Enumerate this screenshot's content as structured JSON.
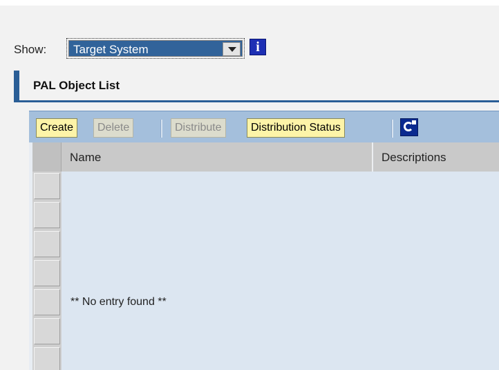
{
  "show": {
    "label": "Show:",
    "selected": "Target System"
  },
  "section": {
    "title": "PAL Object List"
  },
  "toolbar": {
    "create": "Create",
    "delete": "Delete",
    "distribute": "Distribute",
    "distribution_status": "Distribution Status"
  },
  "table": {
    "columns": [
      "Name",
      "Descriptions"
    ],
    "empty_message": "** No entry found **"
  },
  "colors": {
    "accent": "#2a5e96",
    "toolbar_bg": "#a4bfdc",
    "button_bg": "#fdf4a8",
    "table_body": "#dce6f1"
  },
  "icons": {
    "info": "info-icon",
    "refresh": "refresh-icon",
    "dropdown": "chevron-down-icon"
  }
}
